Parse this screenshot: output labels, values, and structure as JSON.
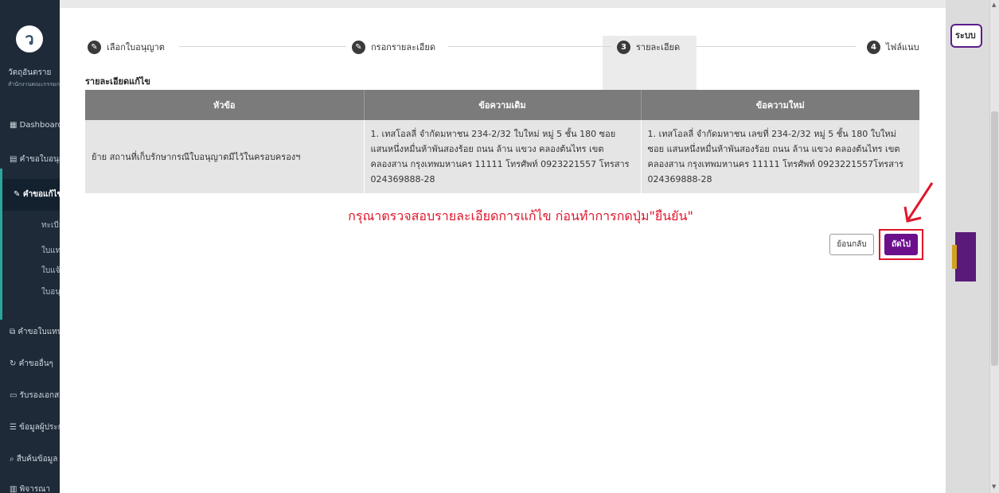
{
  "background": {
    "sidebar": {
      "org_name": "วัตถุอันตราย",
      "org_sub": "สำนักงานคณะกรรมการอาหารและยา",
      "items": [
        {
          "icon": "grid-icon",
          "label": "Dashboard"
        },
        {
          "icon": "document-icon",
          "label": "คำขอใบอนุญาต"
        },
        {
          "icon": "edit-icon",
          "label": "คำขอแก้ไข"
        },
        {
          "icon": "none",
          "label": "ทะเบียน"
        },
        {
          "icon": "none",
          "label": "ใบแทน"
        },
        {
          "icon": "none",
          "label": "ใบแจ้ง"
        },
        {
          "icon": "none",
          "label": "ใบอนุญาต"
        },
        {
          "icon": "copy-icon",
          "label": "คำขอใบแทน"
        },
        {
          "icon": "refresh-icon",
          "label": "คำขออื่นๆ"
        },
        {
          "icon": "card-icon",
          "label": "รับรองเอกสาร"
        },
        {
          "icon": "list-icon",
          "label": "ข้อมูลผู้ประกอบการ"
        },
        {
          "icon": "search-icon",
          "label": "สืบค้นข้อมูล"
        },
        {
          "icon": "book-icon",
          "label": "พิจารณา"
        }
      ]
    },
    "top_right_button": "ระบบ"
  },
  "stepper": {
    "steps": [
      {
        "number": "",
        "icon": "pencil-icon",
        "label": "เลือกใบอนุญาต",
        "state": "done"
      },
      {
        "number": "",
        "icon": "pencil-icon",
        "label": "กรอกรายละเอียด",
        "state": "done"
      },
      {
        "number": "3",
        "icon": "",
        "label": "รายละเอียด",
        "state": "active"
      },
      {
        "number": "4",
        "icon": "",
        "label": "ไฟล์แนบ",
        "state": "pending"
      }
    ]
  },
  "section_title": "รายละเอียดแก้ไข",
  "table": {
    "headers": [
      "หัวข้อ",
      "ข้อความเดิม",
      "ข้อความใหม่"
    ],
    "rows": [
      {
        "topic": "ย้าย สถานที่เก็บรักษากรณีใบอนุญาตมีไว้ในครอบครองฯ",
        "old_text": "1. เทสโอลลี่ จำกัดมหาชน 234-2/32 ใบใหม่ หมู่ 5 ชั้น 180 ซอย แสนหนึ่งหมื่นห้าพันสองร้อย ถนน ล้าน แขวง คลองต้นไทร เขต คลองสาน กรุงเทพมหานคร 11111 โทรศัพท์ 0923221557 โทรสาร 024369888-28",
        "new_text": "1. เทสโอลลี่ จำกัดมหาชน เลขที่ 234-2/32 หมู่ 5 ชั้น 180 ใบใหม่ ซอย แสนหนึ่งหมื่นห้าพันสองร้อย ถนน ล้าน แขวง คลองต้นไทร เขต คลองสาน กรุงเทพมหานคร 11111 โทรศัพท์ 0923221557โทรสาร 024369888-28"
      }
    ]
  },
  "warning_text": "กรุณาตรวจสอบรายละเอียดการแก้ไข ก่อนทำการกดปุ่ม\"ยืนยัน\"",
  "buttons": {
    "back": "ย้อนกลับ",
    "next": "ถัดไป"
  },
  "colors": {
    "primary_purple": "#6b0f8c",
    "warning_red": "#e0162b",
    "table_header": "#7b7b7b"
  }
}
